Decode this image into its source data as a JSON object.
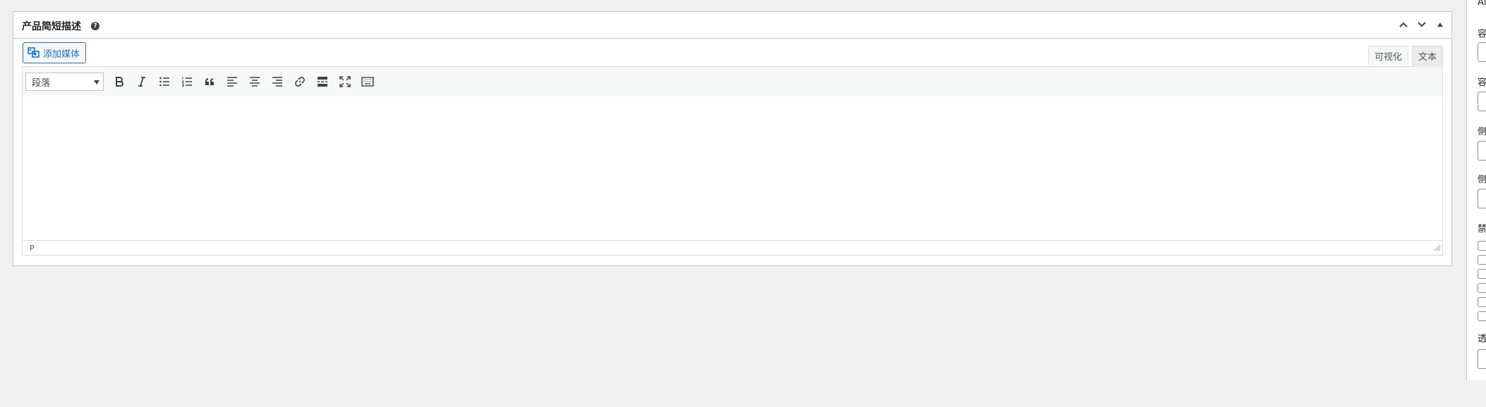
{
  "metabox": {
    "title": "产品简短描述",
    "help_icon": "question-icon",
    "actions": [
      "move-up-icon",
      "move-down-icon",
      "toggle-panel-icon"
    ]
  },
  "editor": {
    "add_media_label": "添加媒体",
    "tabs": [
      "可视化",
      "文本"
    ],
    "active_tab": "可视化",
    "format_select_value": "段落",
    "toolbar_icons": [
      "bold-icon",
      "italic-icon",
      "bulleted-list-icon",
      "numbered-list-icon",
      "blockquote-icon",
      "align-left-icon",
      "align-center-icon",
      "align-right-icon",
      "link-icon",
      "read-more-icon",
      "fullscreen-icon",
      "toolbar-toggle-icon"
    ],
    "status_path": "P"
  },
  "right_panel": {
    "labels": [
      "Ai",
      "容",
      "容",
      "侧",
      "侧",
      "禁",
      "透"
    ]
  }
}
